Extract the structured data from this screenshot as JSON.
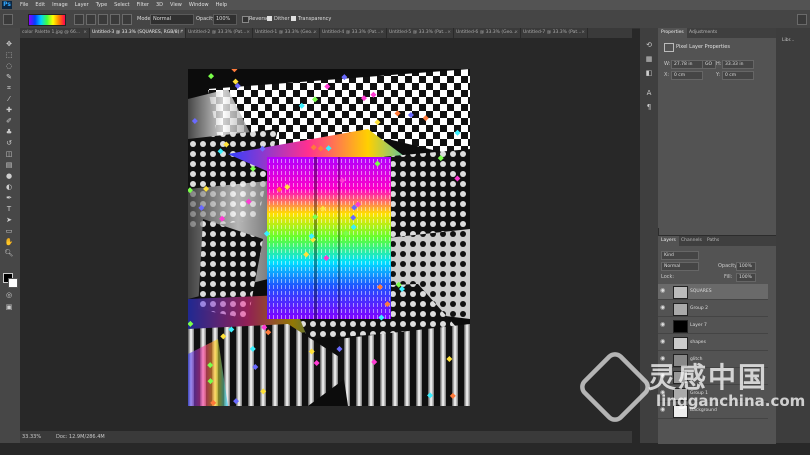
{
  "app": {
    "logo": "Ps"
  },
  "menu": [
    "File",
    "Edit",
    "Image",
    "Layer",
    "Type",
    "Select",
    "Filter",
    "3D",
    "View",
    "Window",
    "Help"
  ],
  "options": {
    "mode_label": "Mode:",
    "mode_value": "Normal",
    "opacity_label": "Opacity:",
    "opacity_value": "100%",
    "reverse_label": "Reverse",
    "dither_label": "Dither",
    "transparency_label": "Transparency"
  },
  "tabs": [
    {
      "label": "color Palette 1.jpg @ 66..."
    },
    {
      "label": "Untitled-3 @ 33.3% (SQUARES, RGB/8) *"
    },
    {
      "label": "Untitled-2 @ 33.3% (Pat..."
    },
    {
      "label": "Untitled-1 @ 33.3% (Geo..."
    },
    {
      "label": "Untitled-4 @ 33.3% (Pat..."
    },
    {
      "label": "Untitled-5 @ 33.3% (Pat..."
    },
    {
      "label": "Untitled-6 @ 33.3% (Geo..."
    },
    {
      "label": "Untitled-7 @ 33.3% (Pat..."
    }
  ],
  "status": {
    "zoom": "33.33%",
    "doc": "Doc: 12.9M/286.4M"
  },
  "properties": {
    "tabs": [
      "Properties",
      "Adjustments"
    ],
    "title": "Pixel Layer Properties",
    "w_label": "W:",
    "w_value": "27.78 in",
    "go_label": "GO",
    "h_label": "H:",
    "h_value": "33.33 in",
    "x_label": "X:",
    "x_value": "0 cm",
    "y_label": "Y:",
    "y_value": "0 cm"
  },
  "layers": {
    "tabs": [
      "Layers",
      "Channels",
      "Paths"
    ],
    "kind": "Kind",
    "blend": "Normal",
    "opacity_label": "Opacity:",
    "opacity_value": "100%",
    "lock_label": "Lock:",
    "fill_label": "Fill:",
    "fill_value": "100%",
    "rows": [
      {
        "name": "SQUARES"
      },
      {
        "name": "Group 2"
      },
      {
        "name": "Layer 7"
      },
      {
        "name": "shapes"
      },
      {
        "name": "glitch"
      },
      {
        "name": ""
      },
      {
        "name": "Group 1"
      },
      {
        "name": "Background"
      }
    ]
  },
  "libraries": {
    "label": "Libr..."
  },
  "watermark": {
    "big": "灵感中国",
    "small": "lingganchina.com"
  },
  "colors": {
    "accent": "#31a8ff",
    "panel": "#535353",
    "chrome": "#454545",
    "canvas_bg": "#282828"
  }
}
